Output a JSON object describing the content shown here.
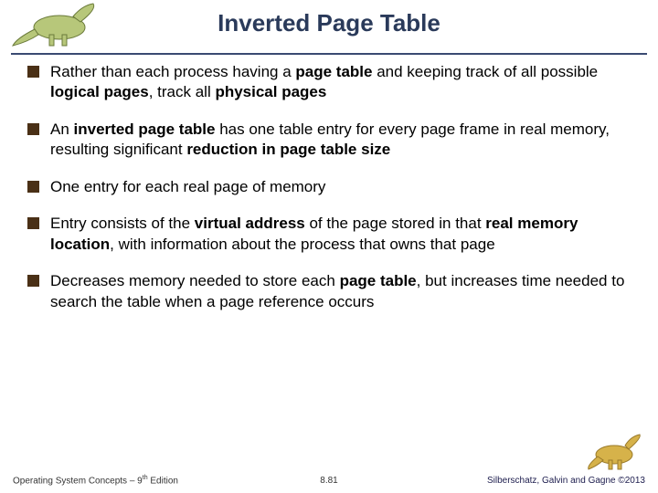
{
  "title": "Inverted Page Table",
  "bullets": [
    "Rather than each process having a <b>page table</b> and keeping track of all possible <b>logical pages</b>, track all <b>physical pages</b>",
    "An <b>inverted page table</b> has one table entry for every page frame in real memory, resulting significant <b>reduction in page table size</b>",
    "One entry for each real page of memory",
    "Entry consists of the <b>virtual address</b> of the page stored in that <b>real memory location</b>, with information about the process that owns that page",
    "Decreases memory needed to store each <b>page table</b>, but increases time needed to search the table when a page reference occurs"
  ],
  "footer": {
    "left_prefix": "Operating System Concepts – 9",
    "left_suffix": " Edition",
    "left_sup": "th",
    "center": "8.81",
    "right": "Silberschatz, Galvin and Gagne ©2013"
  },
  "icons": {
    "top": "dinosaur-green-icon",
    "bottom": "dinosaur-yellow-icon"
  }
}
